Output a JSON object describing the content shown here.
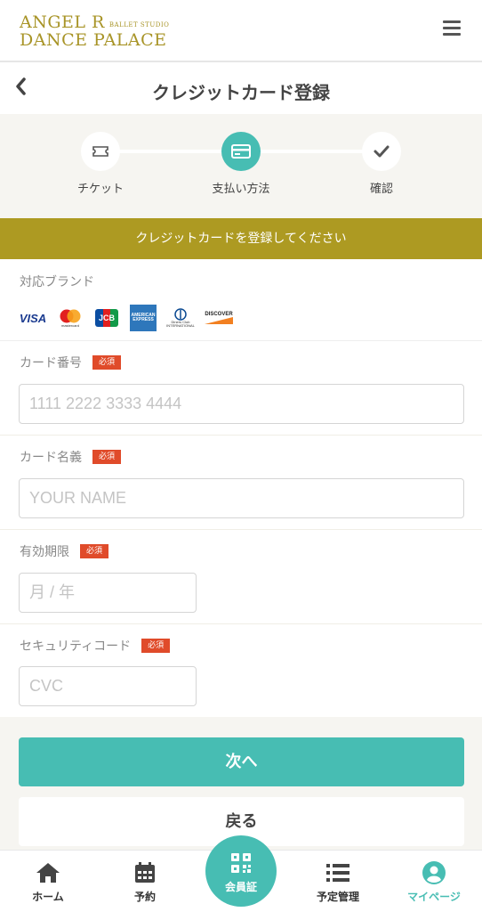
{
  "header": {
    "logo_line1": "ANGEL R",
    "logo_sub": "BALLET STUDIO",
    "logo_line2": "DANCE PALACE",
    "brand_color": "#ad9a22"
  },
  "titlebar": {
    "back_icon": "chevron-left-icon",
    "title": "クレジットカード登録"
  },
  "steps": [
    {
      "label": "チケット",
      "icon": "ticket-icon",
      "active": false
    },
    {
      "label": "支払い方法",
      "icon": "credit-card-icon",
      "active": true
    },
    {
      "label": "確認",
      "icon": "check-icon",
      "active": false
    }
  ],
  "banner": {
    "text": "クレジットカードを登録してください"
  },
  "brands": {
    "label": "対応ブランド",
    "items": [
      "VISA",
      "mastercard",
      "JCB",
      "AMERICAN EXPRESS",
      "Diners Club INTERNATIONAL",
      "DISCOVER"
    ]
  },
  "form": {
    "required_label": "必須",
    "card_number": {
      "label": "カード番号",
      "placeholder": "1111 2222 3333 4444"
    },
    "card_name": {
      "label": "カード名義",
      "placeholder": "YOUR NAME"
    },
    "expiry": {
      "label": "有効期限",
      "placeholder": "月 / 年"
    },
    "cvc": {
      "label": "セキュリティコード",
      "placeholder": "CVC"
    }
  },
  "buttons": {
    "next": "次へ",
    "back": "戻る"
  },
  "tabbar": {
    "items": [
      {
        "label": "ホーム",
        "icon": "home-icon"
      },
      {
        "label": "予約",
        "icon": "calendar-icon"
      },
      {
        "label": "会員証",
        "icon": "qr-code-icon"
      },
      {
        "label": "予定管理",
        "icon": "list-icon"
      },
      {
        "label": "マイページ",
        "icon": "user-icon"
      }
    ],
    "accent_color": "#47bdb3"
  }
}
